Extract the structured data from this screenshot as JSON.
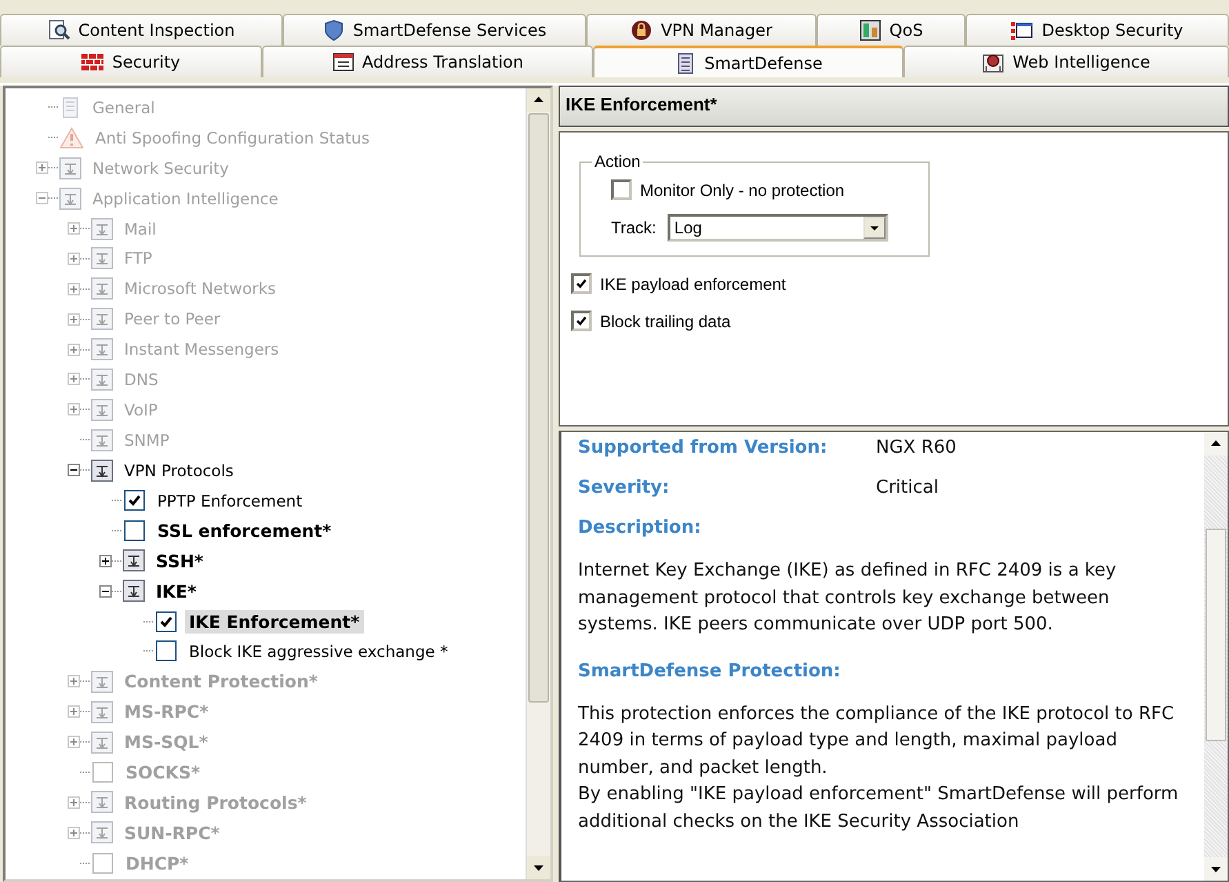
{
  "tab_rows": [
    [
      {
        "label": "Content Inspection",
        "selected": false
      },
      {
        "label": "SmartDefense Services",
        "selected": false
      },
      {
        "label": "VPN Manager",
        "selected": false
      },
      {
        "label": "QoS",
        "selected": false
      },
      {
        "label": "Desktop Security",
        "selected": false
      }
    ],
    [
      {
        "label": "Security",
        "selected": false
      },
      {
        "label": "Address Translation",
        "selected": false
      },
      {
        "label": "SmartDefense",
        "selected": true
      },
      {
        "label": "Web Intelligence",
        "selected": false
      }
    ]
  ],
  "tree": [
    {
      "label": "General",
      "kind": "general",
      "dimmed": true,
      "bold": false,
      "selected": false
    },
    {
      "label": "Anti Spoofing Configuration Status",
      "kind": "alert",
      "dimmed": true,
      "bold": false,
      "selected": false
    },
    {
      "label": "Network Security",
      "kind": "group",
      "expanded": false,
      "dimmed": true,
      "bold": false,
      "selected": false
    },
    {
      "label": "Application Intelligence",
      "kind": "group",
      "expanded": true,
      "dimmed": true,
      "bold": false,
      "selected": false,
      "children": [
        {
          "label": "Mail",
          "kind": "group",
          "expanded": false,
          "dimmed": true,
          "bold": false,
          "selected": false
        },
        {
          "label": "FTP",
          "kind": "group",
          "expanded": false,
          "dimmed": true,
          "bold": false,
          "selected": false
        },
        {
          "label": "Microsoft Networks",
          "kind": "group",
          "expanded": false,
          "dimmed": true,
          "bold": false,
          "selected": false
        },
        {
          "label": "Peer to Peer",
          "kind": "group",
          "expanded": false,
          "dimmed": true,
          "bold": false,
          "selected": false
        },
        {
          "label": "Instant Messengers",
          "kind": "group",
          "expanded": false,
          "dimmed": true,
          "bold": false,
          "selected": false
        },
        {
          "label": "DNS",
          "kind": "group",
          "expanded": false,
          "dimmed": true,
          "bold": false,
          "selected": false
        },
        {
          "label": "VoIP",
          "kind": "group",
          "expanded": false,
          "dimmed": true,
          "bold": false,
          "selected": false
        },
        {
          "label": "SNMP",
          "kind": "group",
          "dimmed": true,
          "bold": false,
          "selected": false
        },
        {
          "label": "VPN Protocols",
          "kind": "group",
          "expanded": true,
          "dimmed": false,
          "bold": false,
          "selected": false,
          "children": [
            {
              "label": "PPTP Enforcement",
              "kind": "check",
              "checked": true,
              "dimmed": false,
              "bold": false,
              "selected": false
            },
            {
              "label": "SSL enforcement*",
              "kind": "check",
              "checked": false,
              "dimmed": false,
              "bold": true,
              "selected": false
            },
            {
              "label": "SSH*",
              "kind": "group",
              "expanded": false,
              "dimmed": false,
              "bold": true,
              "selected": false
            },
            {
              "label": "IKE*",
              "kind": "group",
              "expanded": true,
              "dimmed": false,
              "bold": true,
              "selected": false,
              "children": [
                {
                  "label": "IKE Enforcement*",
                  "kind": "check",
                  "checked": true,
                  "dimmed": false,
                  "bold": true,
                  "selected": true
                },
                {
                  "label": "Block IKE aggressive exchange *",
                  "kind": "check",
                  "checked": false,
                  "dimmed": false,
                  "bold": false,
                  "selected": false
                }
              ]
            }
          ]
        },
        {
          "label": "Content Protection*",
          "kind": "group",
          "expanded": false,
          "dimmed": true,
          "bold": true,
          "selected": false
        },
        {
          "label": "MS-RPC*",
          "kind": "group",
          "expanded": false,
          "dimmed": true,
          "bold": true,
          "selected": false
        },
        {
          "label": "MS-SQL*",
          "kind": "group",
          "expanded": false,
          "dimmed": true,
          "bold": true,
          "selected": false
        },
        {
          "label": "SOCKS*",
          "kind": "check",
          "checked": false,
          "dimmed": true,
          "bold": true,
          "selected": false
        },
        {
          "label": "Routing Protocols*",
          "kind": "group",
          "expanded": false,
          "dimmed": true,
          "bold": true,
          "selected": false
        },
        {
          "label": "SUN-RPC*",
          "kind": "group",
          "expanded": false,
          "dimmed": true,
          "bold": true,
          "selected": false
        },
        {
          "label": "DHCP*",
          "kind": "check",
          "checked": false,
          "dimmed": true,
          "bold": true,
          "selected": false
        }
      ]
    }
  ],
  "settings": {
    "title": "IKE Enforcement*",
    "action": {
      "legend": "Action",
      "monitor_only": {
        "label": "Monitor Only - no protection",
        "checked": false
      },
      "track_label": "Track:",
      "track_value": "Log"
    },
    "options": [
      {
        "label": "IKE payload enforcement",
        "checked": true
      },
      {
        "label": "Block trailing data",
        "checked": true
      }
    ]
  },
  "info": {
    "fields": [
      {
        "label": "Supported from Version:",
        "value": "NGX R60"
      },
      {
        "label": "Severity:",
        "value": "Critical"
      }
    ],
    "sections": [
      {
        "heading": "Description:",
        "paragraphs": [
          "Internet Key Exchange (IKE) as defined in RFC 2409 is a key management protocol that controls key exchange between systems. IKE peers communicate over UDP port 500."
        ]
      },
      {
        "heading": "SmartDefense Protection:",
        "paragraphs": [
          "This protection enforces the compliance of the IKE protocol to RFC 2409 in terms of payload type and length, maximal payload number, and packet length.",
          "By enabling \"IKE payload enforcement\" SmartDefense will perform additional checks on the IKE Security Association"
        ]
      }
    ]
  }
}
